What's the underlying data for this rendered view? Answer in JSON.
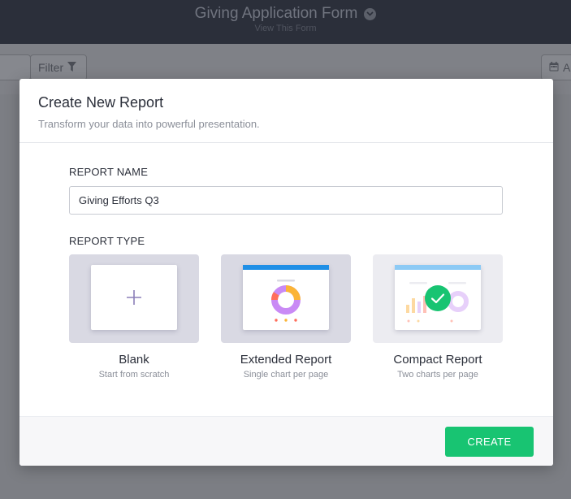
{
  "header": {
    "form_title": "Giving Application Form",
    "view_link": "View This Form"
  },
  "toolbar": {
    "filter_label": "Filter",
    "right_button_label": "A"
  },
  "modal": {
    "title": "Create New Report",
    "description": "Transform your data into powerful presentation.",
    "report_name_label": "REPORT NAME",
    "report_name_value": "Giving Efforts Q3",
    "report_type_label": "REPORT TYPE",
    "report_types": [
      {
        "label": "Blank",
        "subtitle": "Start from scratch",
        "icon": "plus-icon",
        "selected": false
      },
      {
        "label": "Extended Report",
        "subtitle": "Single chart per page",
        "icon": "extended-report-thumbnail",
        "selected": false
      },
      {
        "label": "Compact Report",
        "subtitle": "Two charts per page",
        "icon": "compact-report-thumbnail",
        "selected": true
      }
    ],
    "create_label": "CREATE"
  },
  "colors": {
    "accent_green": "#18c472",
    "header_bg": "#2b2f3a",
    "blue_bar": "#1f8fe6",
    "purple": "#b36ef0"
  }
}
